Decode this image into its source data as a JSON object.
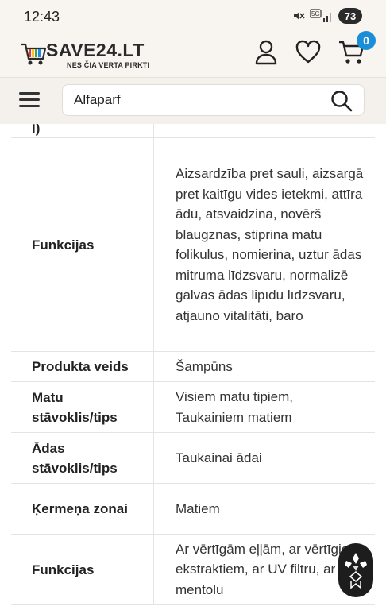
{
  "status": {
    "time": "12:43",
    "battery": "73",
    "network": "5G"
  },
  "header": {
    "logo_name": "SAVE24.LT",
    "logo_tagline": "NES ČIA VERTA PIRKTI",
    "cart_count": "0"
  },
  "search": {
    "value": "Alfaparf"
  },
  "table": {
    "partial_label": "i)",
    "rows": [
      {
        "label": "Funkcijas",
        "value": "Aizsardzība pret sauli, aizsargā pret kaitīgu vides ietekmi, attīra ādu, atsvaidzina, novērš blaugznas, stiprina matu folikulus, nomierina, uztur ādas mitruma līdzsvaru, normalizē galvas ādas lipīdu līdzsvaru, atjauno vitalitāti, baro"
      },
      {
        "label": "Produkta veids",
        "value": "Šampūns"
      },
      {
        "label": "Matu stāvoklis/tips",
        "value": "Visiem matu tipiem, Taukainiem matiem"
      },
      {
        "label": "Ādas stāvoklis/tips",
        "value": "Taukainai ādai"
      },
      {
        "label": "Ķermeņa zonai",
        "value": "Matiem"
      },
      {
        "label": "Funkcijas",
        "value": "Ar vērtīgām eļļām, ar vērtīgiem ekstraktiem, ar UV filtru, ar mentolu"
      }
    ]
  },
  "colors": {
    "accent": "#1a8fd8",
    "header_bg": "#f8f4ef"
  }
}
